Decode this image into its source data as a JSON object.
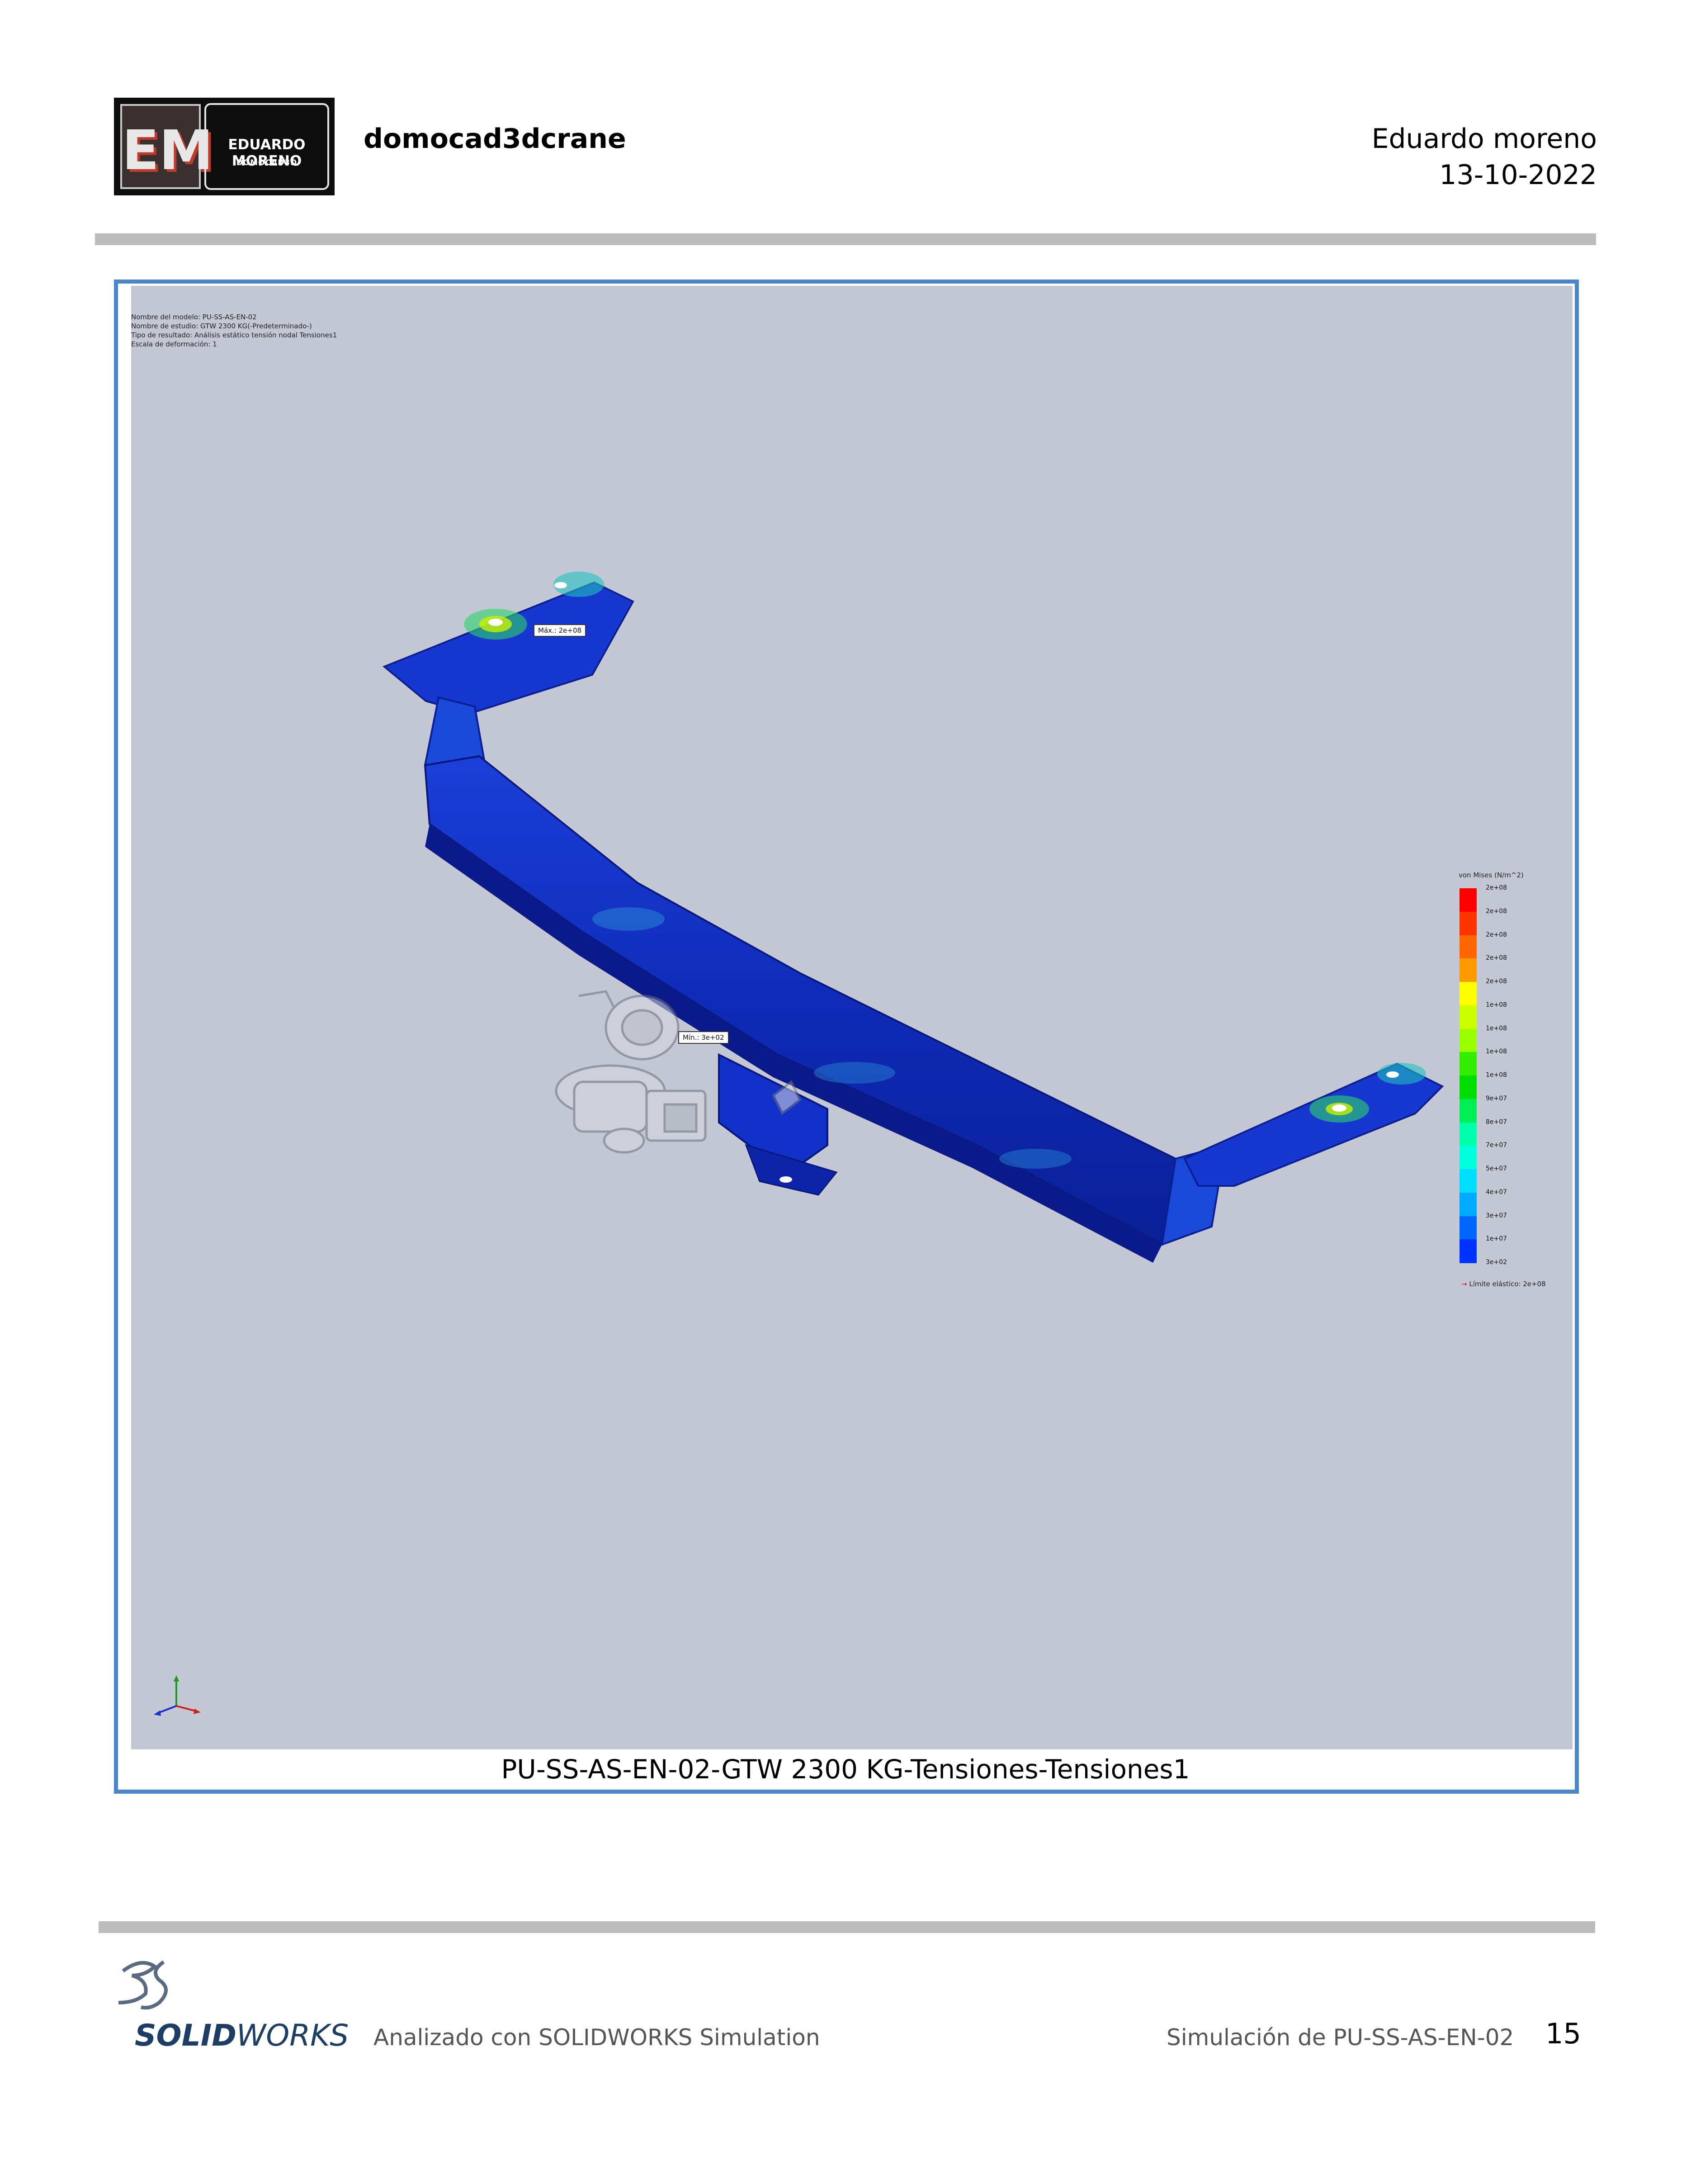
{
  "header": {
    "logo": {
      "line1": "EDUARDO MORENO",
      "line2": "DOMOCAD3D"
    },
    "company": "domocad3dcrane",
    "author": "Eduardo moreno",
    "date": "13-10-2022"
  },
  "figure": {
    "info_lines": [
      "Nombre del modelo: PU-SS-AS-EN-02",
      "Nombre de estudio: GTW 2300 KG(-Predeterminado-)",
      "Tipo de resultado: Análisis estático tensión nodal Tensiones1",
      "Escala de deformación: 1"
    ],
    "max_label": "Máx.: 2e+08",
    "min_label": "Mín.: 3e+02",
    "legend": {
      "title": "von Mises (N/m^2)",
      "ticks": [
        "2e+08",
        "2e+08",
        "2e+08",
        "2e+08",
        "2e+08",
        "1e+08",
        "1e+08",
        "1e+08",
        "1e+08",
        "9e+07",
        "8e+07",
        "7e+07",
        "5e+07",
        "4e+07",
        "3e+07",
        "1e+07",
        "3e+02"
      ],
      "colors": [
        "#ff0000",
        "#ff3300",
        "#ff6600",
        "#ff9900",
        "#ffff00",
        "#ccff00",
        "#99ff00",
        "#33ee00",
        "#00dd00",
        "#00ee55",
        "#00ffaa",
        "#00ffdd",
        "#00ddff",
        "#00aaff",
        "#0066ff",
        "#0033ff",
        "#0000ff"
      ],
      "limit": "Límite elástico: 2e+08"
    },
    "caption": "PU-SS-AS-EN-02-GTW 2300 KG-Tensiones-Tensiones1"
  },
  "footer": {
    "brand_bold": "SOLID",
    "brand_light": "WORKS",
    "left_text": "Analizado con SOLIDWORKS Simulation",
    "right_text": "Simulación de PU-SS-AS-EN-02",
    "page_number": "15"
  }
}
